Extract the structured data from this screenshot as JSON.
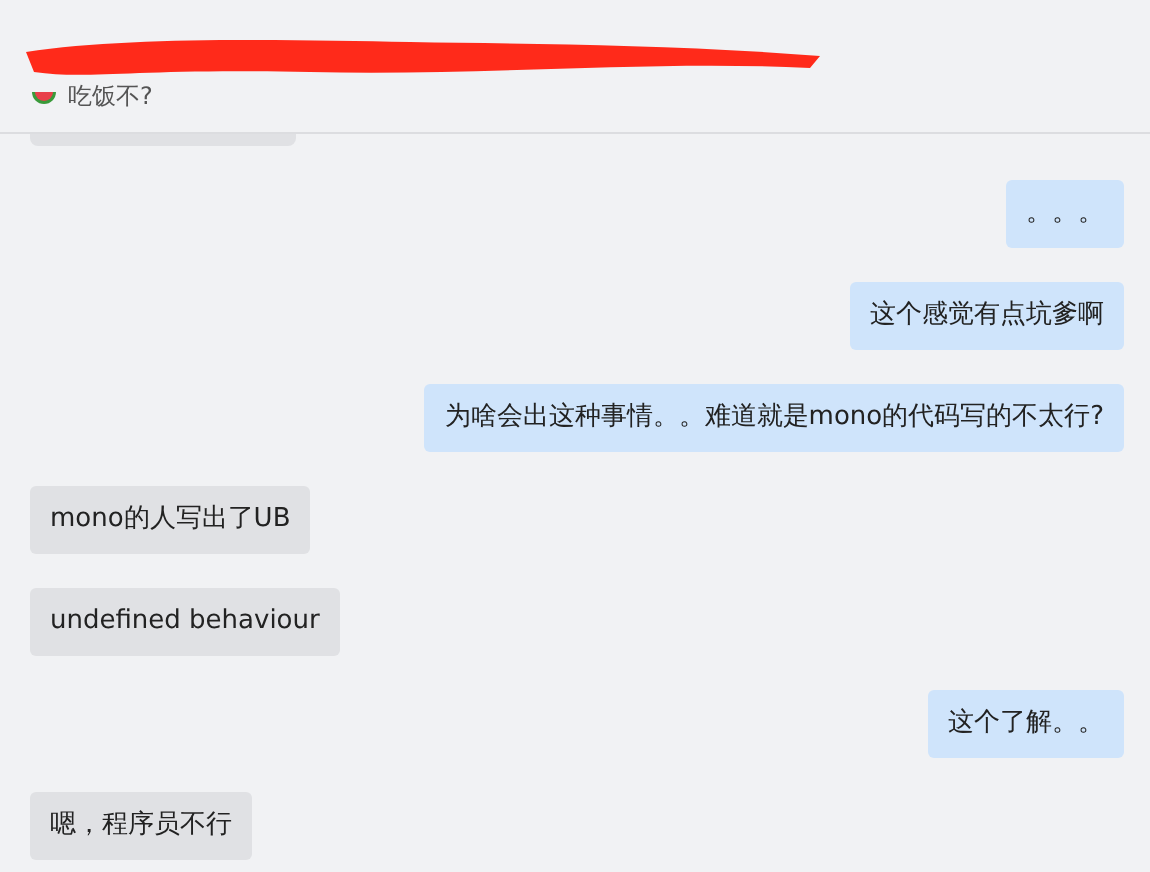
{
  "header": {
    "status": "吃饭不?",
    "title_redacted": true
  },
  "messages": [
    {
      "outgoing": true,
      "text": "。。。"
    },
    {
      "outgoing": true,
      "text": "这个感觉有点坑爹啊"
    },
    {
      "outgoing": true,
      "text": "为啥会出这种事情。。难道就是mono的代码写的不太行?"
    },
    {
      "outgoing": false,
      "text": "mono的人写出了UB"
    },
    {
      "outgoing": false,
      "text": "undefined behaviour"
    },
    {
      "outgoing": true,
      "text": "这个了解。。"
    },
    {
      "outgoing": false,
      "text": "嗯，程序员不行"
    }
  ]
}
